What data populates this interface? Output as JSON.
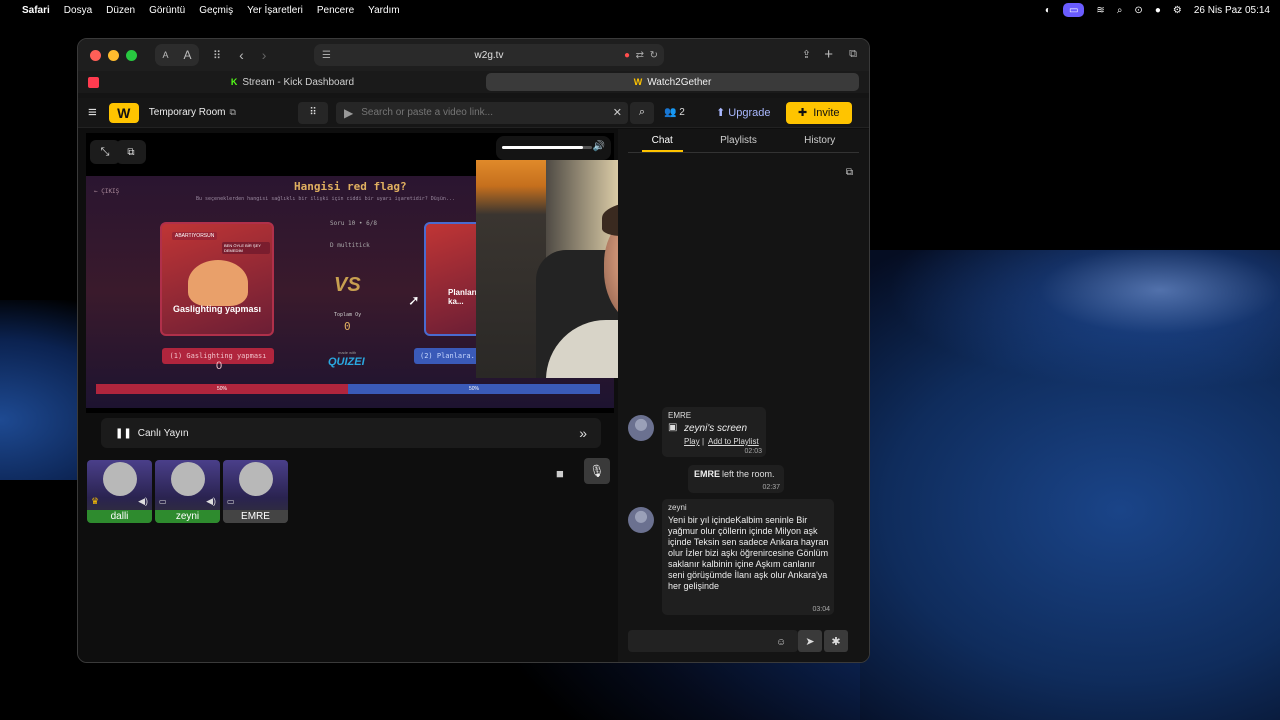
{
  "menubar": {
    "app": "Safari",
    "items": [
      "Dosya",
      "Düzen",
      "Görüntü",
      "Geçmiş",
      "Yer İşaretleri",
      "Pencere",
      "Yardım"
    ],
    "datetime": "26 Nis Paz  05:14"
  },
  "browser": {
    "url": "w2g.tv",
    "reader_small": "A",
    "reader_large": "A",
    "tabs": [
      {
        "label": "Stream - Kick Dashboard",
        "active": false
      },
      {
        "label": "Watch2Gether",
        "active": true
      }
    ]
  },
  "app": {
    "room_title": "Temporary Room",
    "search_placeholder": "Search or paste a video link...",
    "user_count": "2",
    "upgrade_label": "Upgrade",
    "invite_label": "Invite",
    "volume_percent": 90
  },
  "game": {
    "back": "← ÇIKIŞ",
    "title": "Hangisi red flag?",
    "subtitle": "Bu seçeneklerden hangisi sağlıklı bir ilişki için ciddi bir uyarı işaretidir? Düşün...",
    "round": "Soru 10 • 6/8",
    "timer": "D  multitick",
    "vs": "VS",
    "score_label": "Toplam Oy",
    "score_value": "0",
    "made_with": "made with",
    "brand": "QUIZEI",
    "card1_title": "Gaslighting yapması",
    "card1_tag": "ABARTIYORSUN",
    "card1_sticker": "BEN ÖYLE BİR ŞEY DEMEDİM",
    "card2_title": "Planları ka...",
    "opt1": "(1) Gaslighting yapması",
    "opt1_count": "0",
    "opt2": "(2) Planlara...",
    "bar_left": "50%",
    "bar_right": "50%"
  },
  "controls": {
    "status": "Canlı Yayın"
  },
  "participants": [
    {
      "name": "dalli",
      "color": "#2e8b2e"
    },
    {
      "name": "zeyni",
      "color": "#2e8b2e"
    },
    {
      "name": "EMRE",
      "color": "#444444"
    }
  ],
  "sidebar": {
    "tabs": [
      "Chat",
      "Playlists",
      "History"
    ],
    "messages": [
      {
        "user": "EMRE",
        "body": "zeyni's screen",
        "play": "Play",
        "sep": "|",
        "add": "Add to Playlist",
        "time": "02:03"
      },
      {
        "user": "EMRE",
        "system": "left the room.",
        "time": "02:37"
      },
      {
        "user": "zeyni",
        "body": "Yeni bir yıl içindeKalbim seninle Bir yağmur olur çöllerin içinde Milyon aşk içinde Teksin sen sadece Ankara hayran olur İzler bizi aşkı öğrenircesine Gönlüm saklanır kalbinin içine Aşkım canlanır seni görüşümde İlanı aşk olur Ankara'ya her gelişinde",
        "time": "03:04"
      }
    ]
  }
}
